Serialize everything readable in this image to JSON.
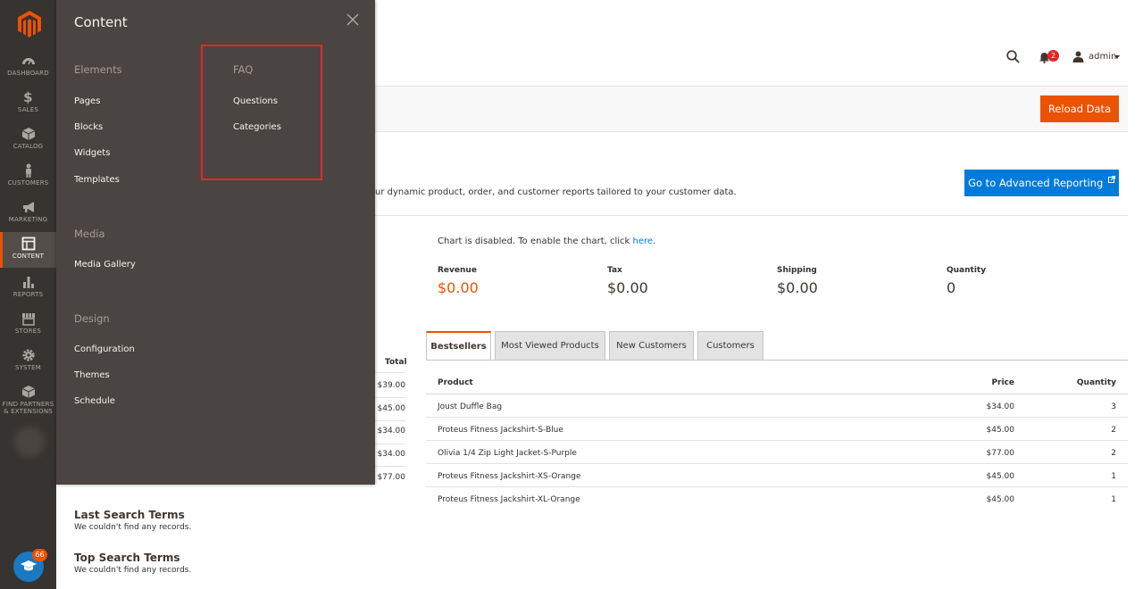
{
  "sidenav": {
    "items": [
      {
        "label": "DASHBOARD",
        "icon": "dashboard-icon"
      },
      {
        "label": "SALES",
        "icon": "dollar-icon"
      },
      {
        "label": "CATALOG",
        "icon": "cube-icon"
      },
      {
        "label": "CUSTOMERS",
        "icon": "person-icon"
      },
      {
        "label": "MARKETING",
        "icon": "megaphone-icon"
      },
      {
        "label": "CONTENT",
        "icon": "layout-icon"
      },
      {
        "label": "REPORTS",
        "icon": "bar-chart-icon"
      },
      {
        "label": "STORES",
        "icon": "storefront-icon"
      },
      {
        "label": "SYSTEM",
        "icon": "gear-icon"
      },
      {
        "label_line1": "FIND PARTNERS",
        "label_line2": "& EXTENSIONS",
        "icon": "box-icon"
      }
    ],
    "helper_badge": "66"
  },
  "flyout": {
    "title": "Content",
    "elements": {
      "heading": "Elements",
      "links": [
        "Pages",
        "Blocks",
        "Widgets",
        "Templates"
      ]
    },
    "faq": {
      "heading": "FAQ",
      "links": [
        "Questions",
        "Categories"
      ]
    },
    "media": {
      "heading": "Media",
      "links": [
        "Media Gallery"
      ]
    },
    "design": {
      "heading": "Design",
      "links": [
        "Configuration",
        "Themes",
        "Schedule"
      ]
    }
  },
  "header": {
    "notifications_count": "2",
    "user": "admin"
  },
  "actions": {
    "reload": "Reload Data",
    "advanced_reporting": "Go to Advanced Reporting"
  },
  "description": "ur dynamic product, order, and customer reports tailored to your customer data.",
  "chart_note": {
    "text": "Chart is disabled. To enable the chart, click ",
    "link": "here",
    "end": "."
  },
  "totals": [
    {
      "label": "Revenue",
      "value": "$0.00"
    },
    {
      "label": "Tax",
      "value": "$0.00"
    },
    {
      "label": "Shipping",
      "value": "$0.00"
    },
    {
      "label": "Quantity",
      "value": "0"
    }
  ],
  "tabs": [
    "Bestsellers",
    "Most Viewed Products",
    "New Customers",
    "Customers"
  ],
  "bestsellers": {
    "headers": {
      "product": "Product",
      "price": "Price",
      "quantity": "Quantity"
    },
    "rows": [
      {
        "product": "Joust Duffle Bag",
        "price": "$34.00",
        "quantity": "3"
      },
      {
        "product": "Proteus Fitness Jackshirt-S-Blue",
        "price": "$45.00",
        "quantity": "2"
      },
      {
        "product": "Olivia 1/4 Zip Light Jacket-S-Purple",
        "price": "$77.00",
        "quantity": "2"
      },
      {
        "product": "Proteus Fitness Jackshirt-XS-Orange",
        "price": "$45.00",
        "quantity": "1"
      },
      {
        "product": "Proteus Fitness Jackshirt-XL-Orange",
        "price": "$45.00",
        "quantity": "1"
      }
    ]
  },
  "last_orders": {
    "header": "Total",
    "values": [
      "$39.00",
      "$45.00",
      "$34.00",
      "$34.00",
      "$77.00"
    ]
  },
  "last_search": {
    "title": "Last Search Terms",
    "empty": "We couldn't find any records."
  },
  "top_search": {
    "title": "Top Search Terms",
    "empty": "We couldn't find any records."
  },
  "colors": {
    "accent": "#eb5202",
    "link": "#007bdb",
    "highlight": "#e02b27",
    "nav_bg": "#373330",
    "flyout_bg": "#4a4542"
  }
}
